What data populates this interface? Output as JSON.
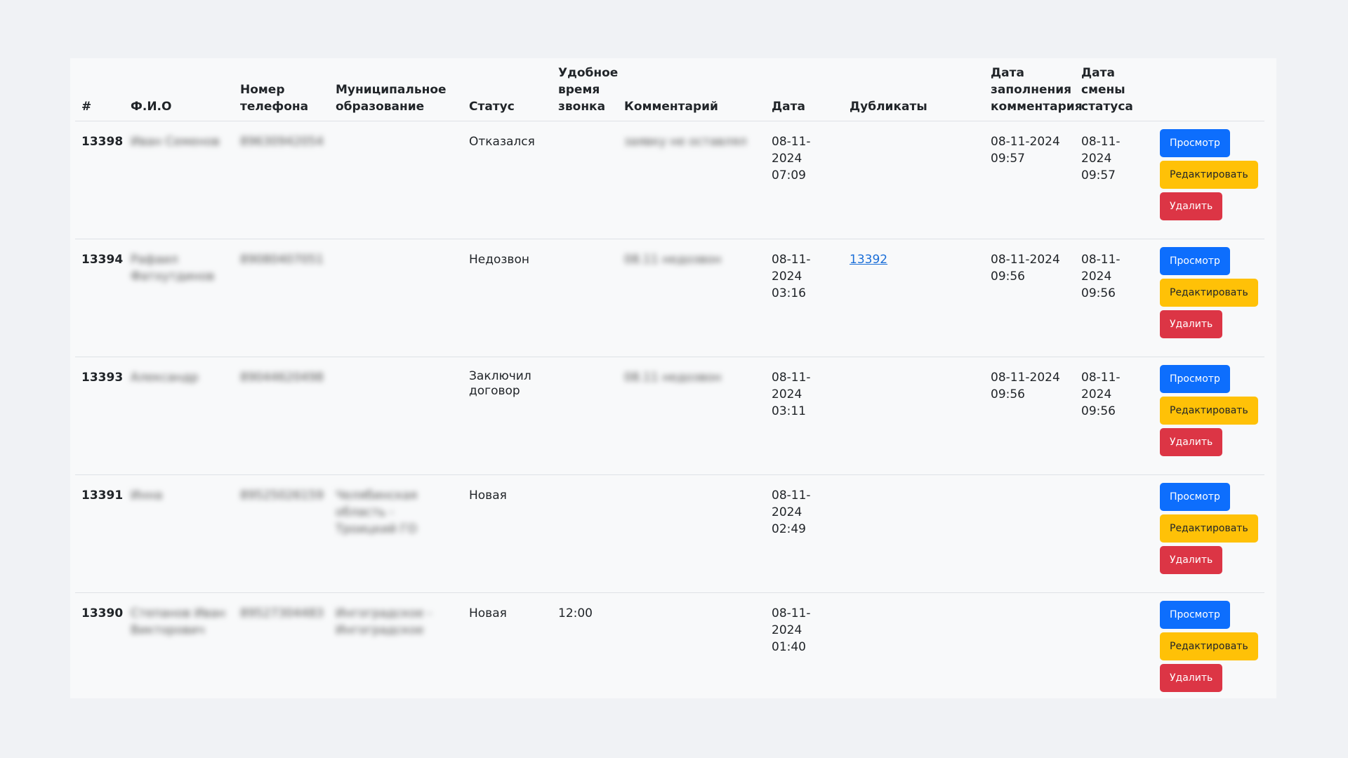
{
  "table": {
    "headers": {
      "id": "#",
      "fio": "Ф.И.О",
      "phone": "Номер телефона",
      "municipality": "Муниципальное образование",
      "status": "Статус",
      "call_time": "Удобное время звонка",
      "comment": "Комментарий",
      "date": "Дата",
      "duplicates": "Дубликаты",
      "comment_date": "Дата заполнения комментария",
      "status_date": "Дата смены статуса"
    },
    "buttons": {
      "view": "Просмотр",
      "edit": "Редактировать",
      "delete": "Удалить"
    },
    "rows": [
      {
        "id": "13398",
        "fio": "Иван Семенов",
        "phone": "89630942054",
        "municipality": "",
        "status": "Отказался",
        "call_time": "",
        "comment": "заявку не оставлял",
        "date": "08-11-2024 07:09",
        "duplicates": "",
        "comment_date": "08-11-2024 09:57",
        "status_date": "08-11-2024 09:57"
      },
      {
        "id": "13394",
        "fio": "Рафаил Фатхутдинов",
        "phone": "89080407051",
        "municipality": "",
        "status": "Недозвон",
        "call_time": "",
        "comment": "08.11 недозвон",
        "date": "08-11-2024 03:16",
        "duplicates": "13392",
        "comment_date": "08-11-2024 09:56",
        "status_date": "08-11-2024 09:56"
      },
      {
        "id": "13393",
        "fio": "Александр",
        "phone": "89044620498",
        "municipality": "",
        "status": "Заключил договор",
        "call_time": "",
        "comment": "08.11 недозвон",
        "date": "08-11-2024 03:11",
        "duplicates": "",
        "comment_date": "08-11-2024 09:56",
        "status_date": "08-11-2024 09:56"
      },
      {
        "id": "13391",
        "fio": "Инна",
        "phone": "89525026159",
        "municipality": "Челябинская область - Троицкий ГО",
        "status": "Новая",
        "call_time": "",
        "comment": "",
        "date": "08-11-2024 02:49",
        "duplicates": "",
        "comment_date": "",
        "status_date": ""
      },
      {
        "id": "13390",
        "fio": "Степанов Иван Викторович",
        "phone": "89527304483",
        "municipality": "Ингоградское - Ингоградское",
        "status": "Новая",
        "call_time": "12:00",
        "comment": "",
        "date": "08-11-2024 01:40",
        "duplicates": "",
        "comment_date": "",
        "status_date": ""
      }
    ]
  }
}
